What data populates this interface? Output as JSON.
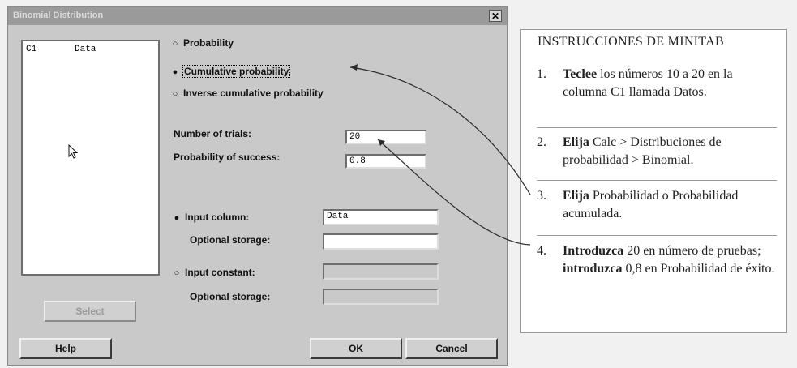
{
  "dialog": {
    "title": "Binomial Distribution",
    "close_glyph": "✕",
    "columns": [
      {
        "id": "C1",
        "name": "Data"
      }
    ],
    "cursor_icon": "arrow-cursor-icon",
    "options": {
      "probability": "Probability",
      "cumulative": "Cumulative probability",
      "inverse": "Inverse cumulative probability",
      "selected": "cumulative"
    },
    "trials_label": "Number of trials:",
    "trials_value": "20",
    "success_label": "Probability of success:",
    "success_value": "0.8",
    "input_column_label": "Input column:",
    "input_column_value": "Data",
    "optional_storage_label": "Optional storage:",
    "input_constant_label": "Input constant:",
    "optional_storage2_label": "Optional storage:",
    "input_mode": "column",
    "buttons": {
      "select": "Select",
      "help": "Help",
      "ok": "OK",
      "cancel": "Cancel"
    }
  },
  "instructions": {
    "title": "INSTRUCCIONES DE MINITAB",
    "steps": [
      {
        "num": "1.",
        "bold": "Teclee",
        "rest": " los números 10 a 20 en la columna C1 llamada Datos."
      },
      {
        "num": "2.",
        "bold": "Elija",
        "rest": " Calc > Distribuciones de probabilidad > Binomial."
      },
      {
        "num": "3.",
        "bold": "Elija",
        "rest": " Probabilidad o Probabilidad acumulada."
      },
      {
        "num": "4.",
        "bold": "Introduzca",
        "rest": " 20 en número de pruebas; ",
        "bold2": "introduzca",
        "rest2": " 0,8 en Probabilidad de éxito."
      }
    ]
  },
  "colors": {
    "dialog_bg": "#c9c9c9",
    "panel_bg": "#ffffff",
    "arrow": "#2b2b2b"
  }
}
